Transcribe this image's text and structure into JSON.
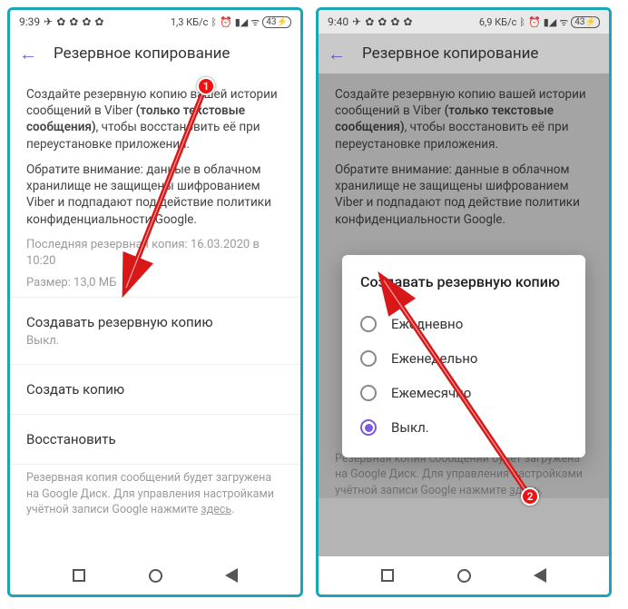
{
  "left": {
    "status": {
      "time": "9:39",
      "net": "1,3 КБ/с",
      "batt": "43"
    },
    "appbar": {
      "title": "Резервное копирование"
    },
    "body": {
      "p1a": "Создайте резервную копию вашей истории сообщений в Viber ",
      "p1bold": "(только текстовые сообщения)",
      "p1b": ", чтобы восстановить её при переустановке приложения.",
      "p2": "Обратите внимание: данные в облачном хранилище не защищены шифрованием Viber и подпадают под действие политики конфиденциальности Google.",
      "last_backup": "Последняя резервная копия: 16.03.2020 в 10:20",
      "size": "Размер: 13,0 МБ",
      "row_schedule_title": "Создавать резервную копию",
      "row_schedule_sub": "Выкл.",
      "row_create": "Создать копию",
      "row_restore": "Восстановить",
      "foot_a": "Резервная копия сообщений будет загружена на Google Диск. Для управления настройками учётной записи Google нажмите ",
      "foot_link": "здесь",
      "foot_b": "."
    }
  },
  "right": {
    "status": {
      "time": "9:40",
      "net": "6,9 КБ/с",
      "batt": "43"
    },
    "appbar": {
      "title": "Резервное копирование"
    },
    "body": {
      "p1a": "Создайте резервную копию вашей истории сообщений в Viber ",
      "p1bold": "(только текстовые сообщения)",
      "p1b": ", чтобы восстановить её при переустановке приложения.",
      "p2": "Обратите внимание: данные в облачном хранилище не защищены шифрованием Viber и подпадают под действие политики конфиденциальности Google.",
      "foot_a": "Резервная копия сообщений будет загружена на Google Диск. Для управления настройками учётной записи Google нажмите ",
      "foot_link": "здесь",
      "foot_b": "."
    },
    "dialog": {
      "title": "Создавать резервную копию",
      "opt1": "Ежедневно",
      "opt2": "Еженедельно",
      "opt3": "Ежемесячно",
      "opt4": "Выкл."
    }
  },
  "badges": {
    "one": "1",
    "two": "2"
  }
}
